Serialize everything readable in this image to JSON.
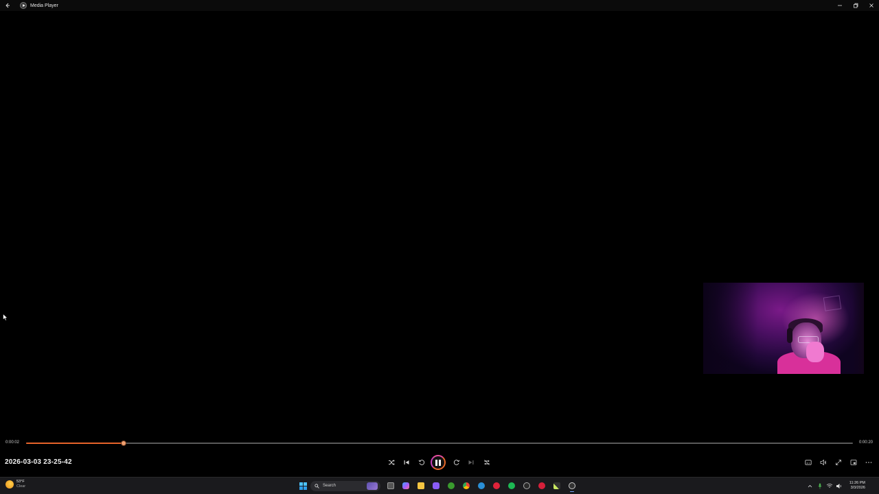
{
  "window": {
    "title": "Media Player",
    "controls": [
      "minimize",
      "maximize",
      "close"
    ]
  },
  "player": {
    "current_time": "0:00:02",
    "duration": "0:00:20",
    "progress_fraction": 0.118,
    "file_title": "2026-03-03 23-25-42",
    "state": "playing",
    "accent_color": "#e8642a",
    "center_controls": [
      {
        "name": "shuffle",
        "icon": "shuffle-icon"
      },
      {
        "name": "previous",
        "icon": "previous-icon"
      },
      {
        "name": "skip-back",
        "icon": "skip-back-10-icon"
      },
      {
        "name": "play-pause",
        "icon": "pause-icon"
      },
      {
        "name": "skip-forward",
        "icon": "skip-forward-30-icon"
      },
      {
        "name": "next",
        "icon": "next-icon",
        "disabled": true
      },
      {
        "name": "repeat",
        "icon": "repeat-off-icon"
      }
    ],
    "right_controls": [
      "subtitles-icon",
      "volume-icon",
      "fullscreen-icon",
      "miniplayer-icon",
      "more-icon"
    ]
  },
  "taskbar": {
    "weather": {
      "temp": "53°F",
      "condition": "Clear"
    },
    "search_placeholder": "Search",
    "apps": [
      "start-icon",
      "search-icon",
      "task-view-icon",
      "copilot-icon",
      "file-explorer-icon",
      "discord-icon",
      "xbox-icon",
      "chrome-icon",
      "steam-icon",
      "opera-gx-icon",
      "spotify-icon",
      "game-launcher-icon",
      "opera-icon",
      "pen-icon",
      "media-player-icon"
    ],
    "tray": [
      "chevron-up-icon",
      "microphone-icon",
      "wifi-icon",
      "speaker-icon"
    ],
    "clock": {
      "time": "11:26 PM",
      "date": "3/3/2026"
    }
  }
}
